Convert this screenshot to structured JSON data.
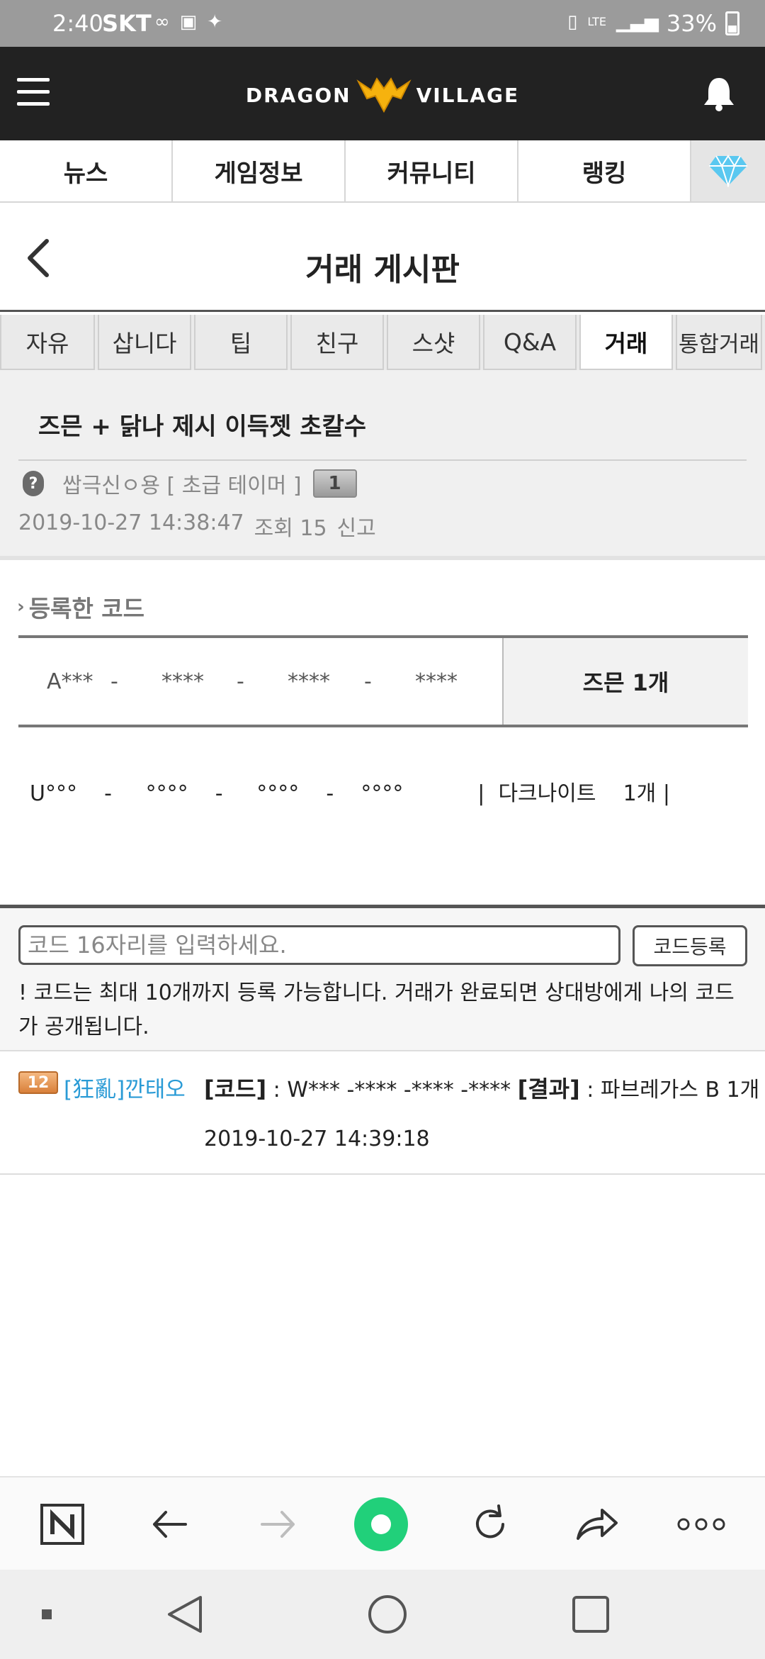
{
  "status_bar": {
    "time": "2:40",
    "carrier": "SKT",
    "network": "LTE",
    "battery": "33%"
  },
  "header": {
    "logo_left": "DRAGON",
    "logo_right": "VILLAGE"
  },
  "main_nav": [
    {
      "label": "뉴스"
    },
    {
      "label": "게임정보"
    },
    {
      "label": "커뮤니티"
    },
    {
      "label": "랭킹"
    }
  ],
  "board": {
    "title": "거래 게시판"
  },
  "category_tabs": [
    {
      "label": "자유",
      "active": false
    },
    {
      "label": "삽니다",
      "active": false
    },
    {
      "label": "팁",
      "active": false
    },
    {
      "label": "친구",
      "active": false
    },
    {
      "label": "스샷",
      "active": false
    },
    {
      "label": "Q&A",
      "active": false
    },
    {
      "label": "거래",
      "active": true
    },
    {
      "label": "통합거래",
      "active": false
    }
  ],
  "post": {
    "title": "즈믄 + 닭나 제시 이득젯 초칼수",
    "author_icon": "?",
    "author": "쌉극신ㅇ용 [ 초급 테이머 ]",
    "level": "1",
    "datetime": "2019-10-27 14:38:47",
    "views": "조회 15",
    "report": "신고"
  },
  "registered_code": {
    "label": "등록한 코드",
    "code_parts": [
      "A***",
      "-",
      "****",
      "-",
      "****",
      "-",
      "****"
    ],
    "reward": "즈믄 1개",
    "note": "U°°°    -     °°°°    -     °°°°    -    °°°°           |  다크나이트    1개 |"
  },
  "code_input": {
    "placeholder": "코드 16자리를 입력하세요.",
    "button": "코드등록",
    "notice": "! 코드는 최대 10개까지 등록 가능합니다. 거래가 완료되면 상대방에게 나의 코드가 공개됩니다."
  },
  "comments": [
    {
      "level": "12",
      "user": "[狂亂]깐태오",
      "code_label": "[코드]",
      "code": " : W*** -**** -**** -**** ",
      "result_label": "[결과]",
      "result": " : 파브레가스 B 1개",
      "datetime": "2019-10-27 14:39:18"
    }
  ],
  "icons": {
    "menu": "hamburger-icon",
    "notifications": "bell-icon",
    "gem": "diamond-icon",
    "back": "chevron-left-icon"
  },
  "colors": {
    "header_bg": "#222222",
    "accent_blue": "#2a9bd6",
    "gem_blue": "#5ac8f0",
    "whale_green": "#21d07a"
  }
}
